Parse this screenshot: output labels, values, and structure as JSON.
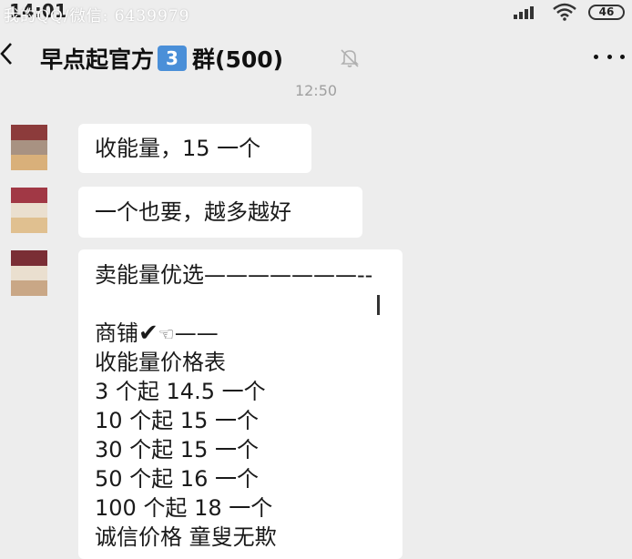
{
  "status_bar": {
    "time": "14:01",
    "watermark": "我的QQ/微信: 6439979",
    "battery": "46"
  },
  "nav": {
    "group_name": "早点起官方",
    "group_number_badge": "3",
    "group_suffix": "群(500)"
  },
  "timestamp": "12:50",
  "messages": [
    {
      "lines": [
        "收能量，15 一个"
      ],
      "avatar_colors": [
        "#8c3b3b",
        "#a89282",
        "#d9b07a"
      ]
    },
    {
      "lines": [
        "一个也要，越多越好"
      ],
      "avatar_colors": [
        "#a13845",
        "#eadfcf",
        "#e0c090"
      ]
    },
    {
      "lines": [
        "卖能量优选———————--",
        "",
        "商铺",
        "收能量价格表",
        "3 个起 14.5 一个",
        "10 个起 15 一个",
        "30 个起 15 一个",
        "50 个起 16 一个",
        "100 个起 18 一个",
        "诚信价格 童叟无欺"
      ],
      "shop_suffix_dash": "——",
      "avatar_colors": [
        "#7a2e35",
        "#eadfcf",
        "#c9a786"
      ]
    }
  ],
  "colors": {
    "background": "#ededed",
    "bubble": "#ffffff",
    "badge": "#4a8fd8"
  }
}
